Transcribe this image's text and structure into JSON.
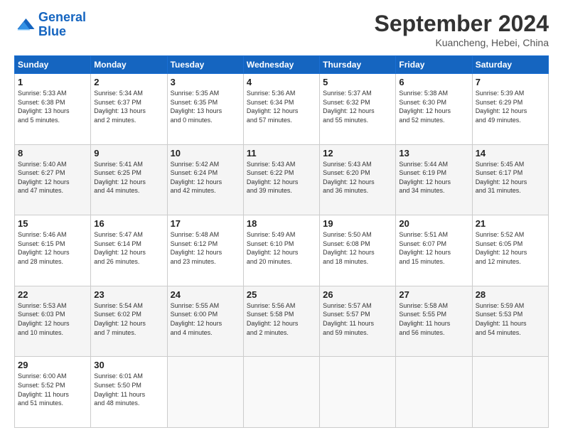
{
  "header": {
    "logo_line1": "General",
    "logo_line2": "Blue",
    "month": "September 2024",
    "location": "Kuancheng, Hebei, China"
  },
  "weekdays": [
    "Sunday",
    "Monday",
    "Tuesday",
    "Wednesday",
    "Thursday",
    "Friday",
    "Saturday"
  ],
  "weeks": [
    [
      {
        "day": "1",
        "sunrise": "5:33 AM",
        "sunset": "6:38 PM",
        "daylight": "13 hours and 5 minutes."
      },
      {
        "day": "2",
        "sunrise": "5:34 AM",
        "sunset": "6:37 PM",
        "daylight": "13 hours and 2 minutes."
      },
      {
        "day": "3",
        "sunrise": "5:35 AM",
        "sunset": "6:35 PM",
        "daylight": "13 hours and 0 minutes."
      },
      {
        "day": "4",
        "sunrise": "5:36 AM",
        "sunset": "6:34 PM",
        "daylight": "12 hours and 57 minutes."
      },
      {
        "day": "5",
        "sunrise": "5:37 AM",
        "sunset": "6:32 PM",
        "daylight": "12 hours and 55 minutes."
      },
      {
        "day": "6",
        "sunrise": "5:38 AM",
        "sunset": "6:30 PM",
        "daylight": "12 hours and 52 minutes."
      },
      {
        "day": "7",
        "sunrise": "5:39 AM",
        "sunset": "6:29 PM",
        "daylight": "12 hours and 49 minutes."
      }
    ],
    [
      {
        "day": "8",
        "sunrise": "5:40 AM",
        "sunset": "6:27 PM",
        "daylight": "12 hours and 47 minutes."
      },
      {
        "day": "9",
        "sunrise": "5:41 AM",
        "sunset": "6:25 PM",
        "daylight": "12 hours and 44 minutes."
      },
      {
        "day": "10",
        "sunrise": "5:42 AM",
        "sunset": "6:24 PM",
        "daylight": "12 hours and 42 minutes."
      },
      {
        "day": "11",
        "sunrise": "5:43 AM",
        "sunset": "6:22 PM",
        "daylight": "12 hours and 39 minutes."
      },
      {
        "day": "12",
        "sunrise": "5:43 AM",
        "sunset": "6:20 PM",
        "daylight": "12 hours and 36 minutes."
      },
      {
        "day": "13",
        "sunrise": "5:44 AM",
        "sunset": "6:19 PM",
        "daylight": "12 hours and 34 minutes."
      },
      {
        "day": "14",
        "sunrise": "5:45 AM",
        "sunset": "6:17 PM",
        "daylight": "12 hours and 31 minutes."
      }
    ],
    [
      {
        "day": "15",
        "sunrise": "5:46 AM",
        "sunset": "6:15 PM",
        "daylight": "12 hours and 28 minutes."
      },
      {
        "day": "16",
        "sunrise": "5:47 AM",
        "sunset": "6:14 PM",
        "daylight": "12 hours and 26 minutes."
      },
      {
        "day": "17",
        "sunrise": "5:48 AM",
        "sunset": "6:12 PM",
        "daylight": "12 hours and 23 minutes."
      },
      {
        "day": "18",
        "sunrise": "5:49 AM",
        "sunset": "6:10 PM",
        "daylight": "12 hours and 20 minutes."
      },
      {
        "day": "19",
        "sunrise": "5:50 AM",
        "sunset": "6:08 PM",
        "daylight": "12 hours and 18 minutes."
      },
      {
        "day": "20",
        "sunrise": "5:51 AM",
        "sunset": "6:07 PM",
        "daylight": "12 hours and 15 minutes."
      },
      {
        "day": "21",
        "sunrise": "5:52 AM",
        "sunset": "6:05 PM",
        "daylight": "12 hours and 12 minutes."
      }
    ],
    [
      {
        "day": "22",
        "sunrise": "5:53 AM",
        "sunset": "6:03 PM",
        "daylight": "12 hours and 10 minutes."
      },
      {
        "day": "23",
        "sunrise": "5:54 AM",
        "sunset": "6:02 PM",
        "daylight": "12 hours and 7 minutes."
      },
      {
        "day": "24",
        "sunrise": "5:55 AM",
        "sunset": "6:00 PM",
        "daylight": "12 hours and 4 minutes."
      },
      {
        "day": "25",
        "sunrise": "5:56 AM",
        "sunset": "5:58 PM",
        "daylight": "12 hours and 2 minutes."
      },
      {
        "day": "26",
        "sunrise": "5:57 AM",
        "sunset": "5:57 PM",
        "daylight": "11 hours and 59 minutes."
      },
      {
        "day": "27",
        "sunrise": "5:58 AM",
        "sunset": "5:55 PM",
        "daylight": "11 hours and 56 minutes."
      },
      {
        "day": "28",
        "sunrise": "5:59 AM",
        "sunset": "5:53 PM",
        "daylight": "11 hours and 54 minutes."
      }
    ],
    [
      {
        "day": "29",
        "sunrise": "6:00 AM",
        "sunset": "5:52 PM",
        "daylight": "11 hours and 51 minutes."
      },
      {
        "day": "30",
        "sunrise": "6:01 AM",
        "sunset": "5:50 PM",
        "daylight": "11 hours and 48 minutes."
      },
      null,
      null,
      null,
      null,
      null
    ]
  ]
}
